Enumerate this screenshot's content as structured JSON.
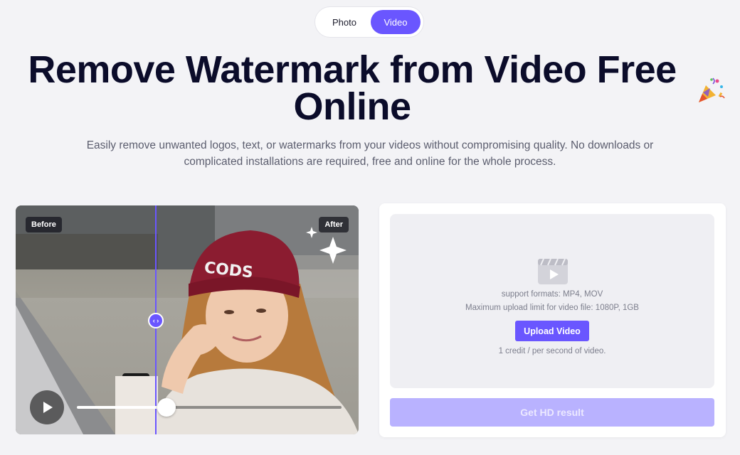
{
  "mode_toggle": {
    "photo_label": "Photo",
    "video_label": "Video",
    "selected": "Video"
  },
  "hero": {
    "title": "Remove Watermark from Video Free Online",
    "subtitle": "Easily remove unwanted logos, text, or watermarks from your videos without compromising quality. No downloads or complicated installations are required, free and online for the whole process."
  },
  "compare": {
    "before_label": "Before",
    "after_label": "After",
    "handle_glyph": "‹ ›",
    "play_icon": "play-icon",
    "playback_progress": 0.34
  },
  "upload": {
    "icon": "video-clapper-icon",
    "formats": "support formats: MP4, MOV",
    "limit": "Maximum upload limit for video file: 1080P, 1GB",
    "button_label": "Upload Video",
    "credit_note": "1 credit / per second of video."
  },
  "result": {
    "button_label": "Get HD result"
  },
  "colors": {
    "accent": "#6a56ff",
    "accent_disabled": "#b9b2ff",
    "background": "#f3f3f6"
  }
}
